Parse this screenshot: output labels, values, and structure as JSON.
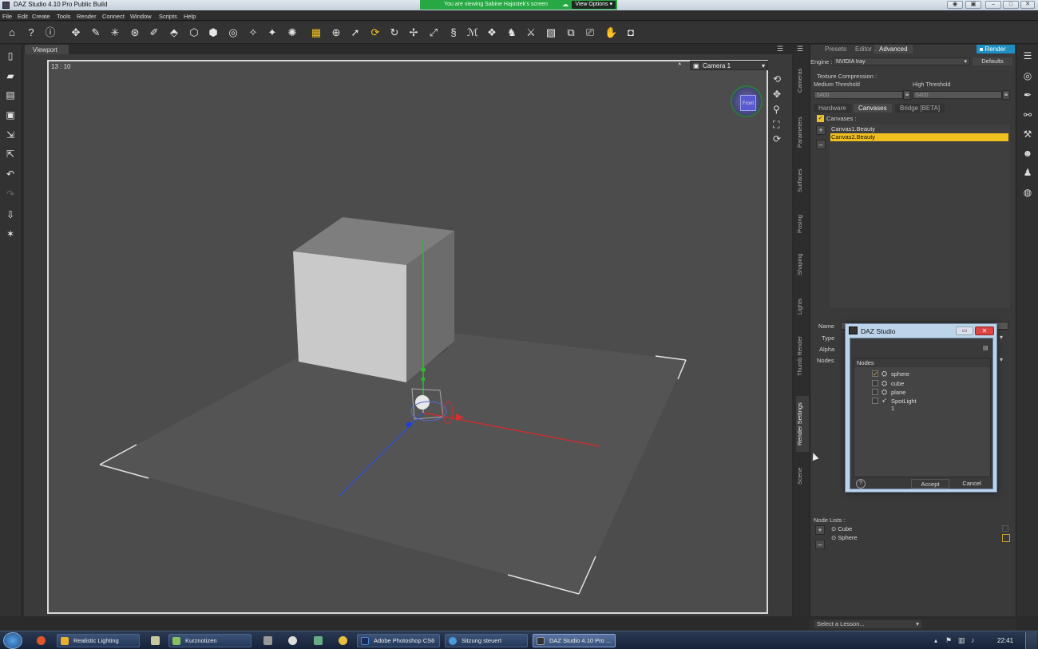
{
  "window": {
    "title": "DAZ Studio 4.10 Pro Public Build",
    "btn_min": "–",
    "btn_max": "□",
    "btn_close": "✕"
  },
  "share": {
    "message": "You are viewing Sabine Hajostek's screen",
    "view_options": "View Options"
  },
  "menu": [
    "File",
    "Edit",
    "Create",
    "Tools",
    "Render",
    "Connect",
    "Window",
    "Scripts",
    "Help"
  ],
  "viewport": {
    "tab": "Viewport",
    "aspect_ratio": "13 : 10",
    "camera": "Camera 1",
    "cube_face": "Front"
  },
  "side_tabs": [
    "Cameras",
    "Parameters",
    "Surfaces",
    "Posing",
    "Shaping",
    "Lights",
    "Thumb Render",
    "Render Settings",
    "Scene"
  ],
  "render_panel": {
    "tabs": [
      "Presets",
      "Editor",
      "Advanced"
    ],
    "active_tab": "Advanced",
    "render_button": "Render",
    "engine_label": "Engine :",
    "engine_value": "NVIDIA Iray",
    "defaults_button": "Defaults",
    "texture_compression": "Texture Compression :",
    "medium_threshold_label": "Medium Threshold",
    "medium_threshold_value": "6400",
    "high_threshold_label": "High Threshold",
    "high_threshold_value": "6400",
    "sub_tabs": [
      "Hardware",
      "Canvases",
      "Bridge [BETA]"
    ],
    "active_sub_tab": "Canvases",
    "canvases_label": "Canvases :",
    "canvases": [
      "Canvas1.Beauty",
      "Canvas2.Beauty"
    ],
    "selected_canvas": "Canvas2.Beauty",
    "prop_labels": [
      "Name",
      "Type",
      "Alpha",
      "Nodes"
    ],
    "node_lists_label": "Node Lists :",
    "node_lists": [
      "Cube",
      "Sphere"
    ],
    "lesson": "Select a Lesson..."
  },
  "dialog": {
    "title": "DAZ Studio",
    "nodes_header": "Nodes",
    "nodes": [
      {
        "name": "sphere",
        "checked": true
      },
      {
        "name": "cube",
        "checked": false
      },
      {
        "name": "plane",
        "checked": false
      },
      {
        "name": "SpotLight 1",
        "checked": false
      }
    ],
    "accept": "Accept",
    "cancel": "Cancel",
    "help": "?"
  },
  "taskbar": {
    "items": [
      "Realistic Lighting",
      "Kurznotizen",
      "Adobe Photoshop CS6",
      "Sitzung steuert",
      "DAZ Studio 4.10 Pro ..."
    ],
    "clock": "22:41"
  },
  "colors": {
    "selection": "#f0c020",
    "share_bar": "#27a844",
    "render_button": "#1f8fc0"
  }
}
